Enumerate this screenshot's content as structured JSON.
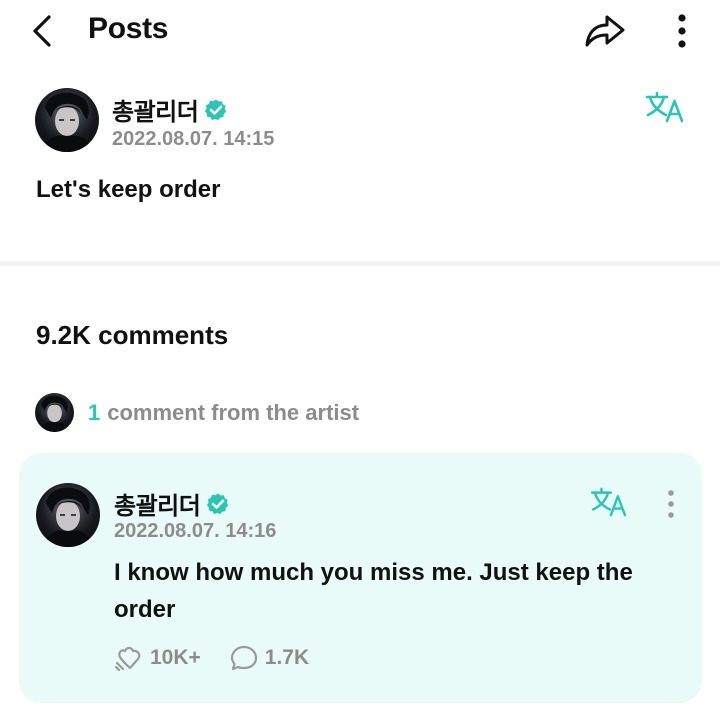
{
  "header": {
    "title": "Posts",
    "icons": {
      "back": "chevron-left-icon",
      "share": "share-icon",
      "more": "more-vertical-icon"
    }
  },
  "post": {
    "author": "총괄리더",
    "verified_icon": "verified-badge-icon",
    "date": "2022.08.07. 14:15",
    "text": "Let's keep order",
    "translate_icon": "translate-icon"
  },
  "comments": {
    "count_label": "9.2K comments",
    "artist_summary": {
      "count": "1",
      "text": "comment from the artist"
    },
    "artist_comment": {
      "author": "총괄리더",
      "date": "2022.08.07. 14:16",
      "text": "I know how much you miss me. Just keep the order",
      "likes": "10K+",
      "replies": "1.7K"
    }
  },
  "colors": {
    "accent": "#2ac6b3",
    "card_background": "#e8fbf8",
    "muted_text": "#8c8c8c"
  }
}
